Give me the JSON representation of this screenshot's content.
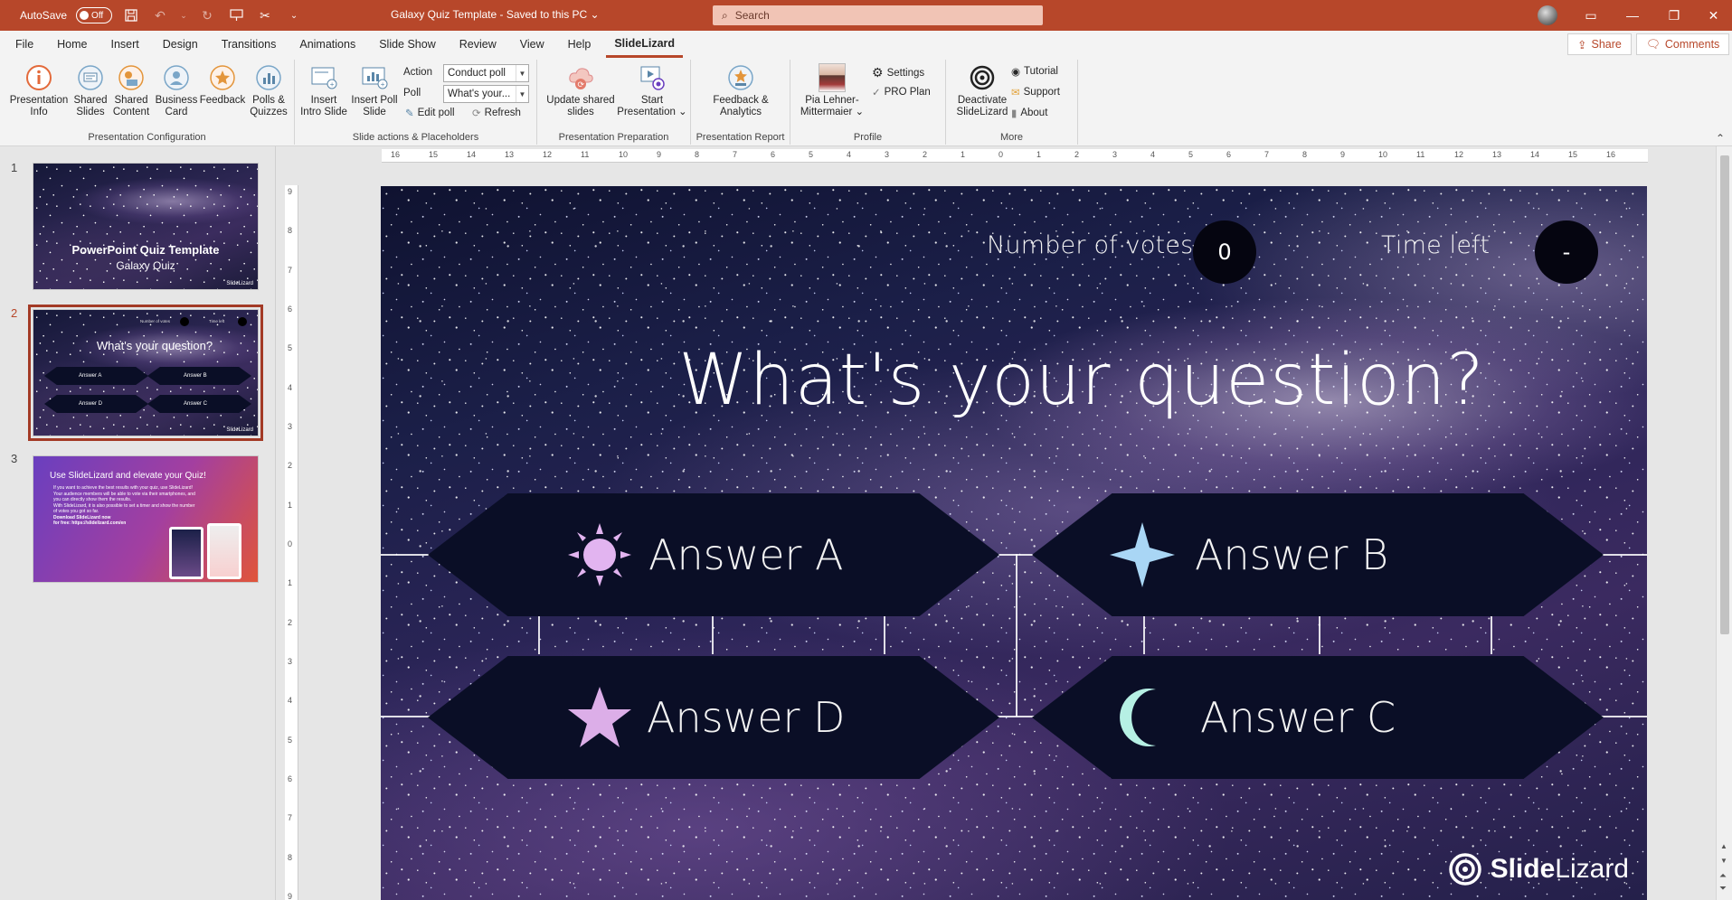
{
  "titlebar": {
    "autosave_label": "AutoSave",
    "autosave_state": "Off",
    "doc_title": "Galaxy Quiz Template  -  Saved to this PC  ⌄",
    "search_placeholder": "Search"
  },
  "menu": {
    "tabs": [
      "File",
      "Home",
      "Insert",
      "Design",
      "Transitions",
      "Animations",
      "Slide Show",
      "Review",
      "View",
      "Help",
      "SlideLizard"
    ],
    "active": "SlideLizard",
    "share": "Share",
    "comments": "Comments"
  },
  "ribbon": {
    "groups": {
      "config": "Presentation Configuration",
      "slide_actions": "Slide actions & Placeholders",
      "prep": "Presentation Preparation",
      "report": "Presentation Report",
      "profile": "Profile",
      "more": "More"
    },
    "buttons": {
      "presentation_info": "Presentation Info",
      "shared_slides": "Shared Slides",
      "shared_content": "Shared Content",
      "business_card": "Business Card",
      "feedback": "Feedback",
      "polls_quizzes": "Polls & Quizzes",
      "insert_intro": "Insert Intro Slide",
      "insert_poll": "Insert Poll Slide",
      "action_label": "Action",
      "poll_label": "Poll",
      "action_value": "Conduct poll",
      "poll_value": "What's your...",
      "edit_poll": "Edit poll",
      "refresh": "Refresh",
      "update_shared": "Update shared slides",
      "start_presentation": "Start Presentation ⌄",
      "feedback_analytics": "Feedback & Analytics",
      "profile_name": "Pia Lehner-Mittermaier ⌄",
      "settings": "Settings",
      "pro_plan": "PRO Plan",
      "deactivate": "Deactivate SlideLizard",
      "tutorial": "Tutorial",
      "support": "Support",
      "about": "About"
    }
  },
  "thumbnails": [
    {
      "num": "1",
      "title": "PowerPoint Quiz Template",
      "subtitle": "Galaxy Quiz",
      "brand": "SlideLizard"
    },
    {
      "num": "2",
      "title": "What's your question?",
      "votes_label": "Number of votes",
      "time_label": "Time left",
      "answers": [
        "Answer A",
        "Answer B",
        "Answer D",
        "Answer C"
      ],
      "brand": "SlideLizard"
    },
    {
      "num": "3",
      "title": "Use SlideLizard and elevate your Quiz!",
      "bullets": [
        "If you want to achieve the best results with your quiz, use SlideLizard! Your audience members will be able to vote via their smartphones, and you can directly show them the results.",
        "With SlideLizard, it is also possible to set a timer and show the number of votes you got so far.",
        "Download SlideLizard now",
        "for free: https://slidelizard.com/en"
      ]
    }
  ],
  "hruler_ticks": [
    "16",
    "15",
    "14",
    "13",
    "12",
    "11",
    "10",
    "9",
    "8",
    "7",
    "6",
    "5",
    "4",
    "3",
    "2",
    "1",
    "0",
    "1",
    "2",
    "3",
    "4",
    "5",
    "6",
    "7",
    "8",
    "9",
    "10",
    "11",
    "12",
    "13",
    "14",
    "15",
    "16"
  ],
  "vruler_ticks": [
    "9",
    "8",
    "7",
    "6",
    "5",
    "4",
    "3",
    "2",
    "1",
    "0",
    "1",
    "2",
    "3",
    "4",
    "5",
    "6",
    "7",
    "8",
    "9"
  ],
  "slide": {
    "votes_label": "Number of votes",
    "votes_value": "0",
    "time_label": "Time left",
    "time_value": "-",
    "question": "What's your question?",
    "answers": {
      "a": "Answer A",
      "b": "Answer B",
      "d": "Answer D",
      "c": "Answer C"
    },
    "brand_bold": "Slide",
    "brand_light": "Lizard",
    "colors": {
      "sun": "#e2b4f0",
      "sparkle": "#a9d6f5",
      "star": "#dcaee8",
      "moon": "#b6f0e4",
      "answer_bg": "#0a0e26"
    }
  }
}
